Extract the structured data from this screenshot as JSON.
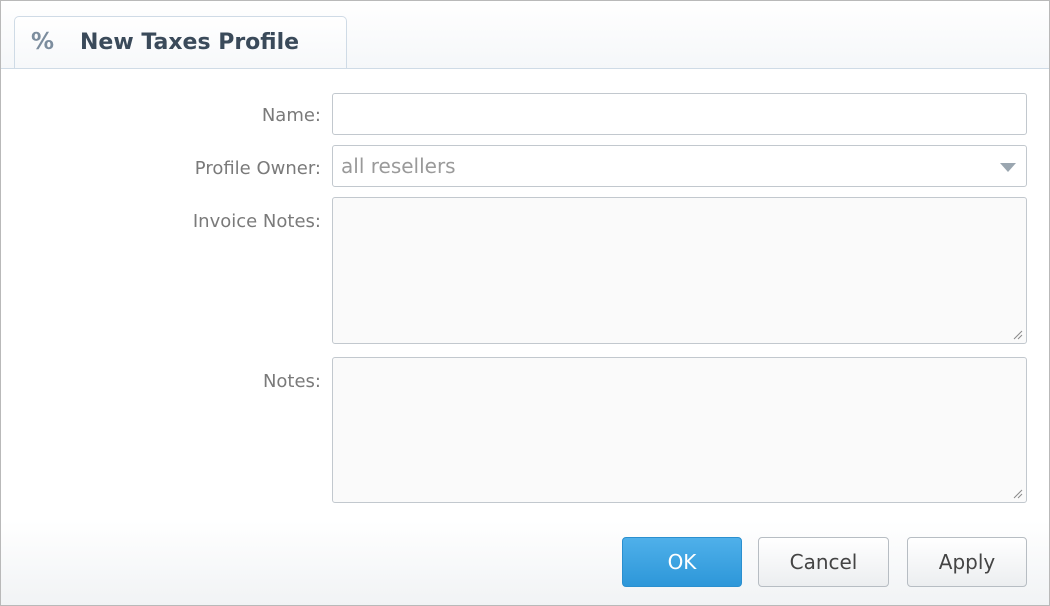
{
  "tab": {
    "icon": "percent-icon",
    "icon_glyph": "%",
    "title": "New Taxes Profile"
  },
  "form": {
    "name": {
      "label": "Name:",
      "value": ""
    },
    "profile_owner": {
      "label": "Profile Owner:",
      "value": "all resellers"
    },
    "invoice_notes": {
      "label": "Invoice Notes:",
      "value": ""
    },
    "notes": {
      "label": "Notes:",
      "value": ""
    }
  },
  "buttons": {
    "ok": "OK",
    "cancel": "Cancel",
    "apply": "Apply"
  },
  "colors": {
    "primary_button": "#2d97d9",
    "label_text": "#7a7a7a"
  }
}
